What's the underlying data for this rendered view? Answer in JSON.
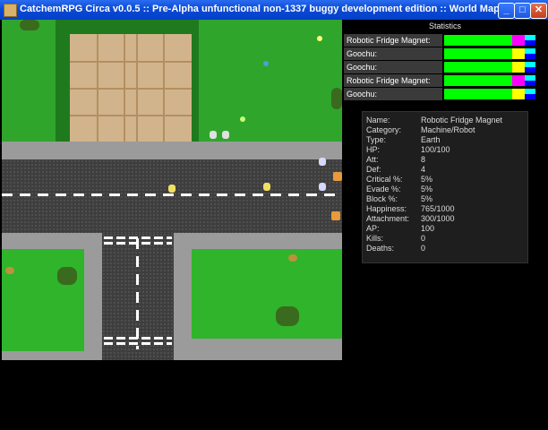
{
  "window": {
    "title": "CatchemRPG Circa v0.0.5 :: Pre-Alpha unfunctional non-1337 buggy development edition :: World Map",
    "minimize_label": "_",
    "maximize_label": "□",
    "close_label": "✕"
  },
  "statistics": {
    "title": "Statistics",
    "rows": [
      {
        "name": "Robotic Fridge Magnet:"
      },
      {
        "name": "Goochu:"
      },
      {
        "name": "Goochu:"
      },
      {
        "name": "Robotic Fridge Magnet:"
      },
      {
        "name": "Goochu:"
      }
    ],
    "colors": {
      "hp": "#00ff00",
      "magenta": "#ff00ff",
      "yellow": "#ffff00",
      "cyan": "#00ffff",
      "blue": "#0000ff"
    }
  },
  "details": [
    {
      "key": "Name:",
      "value": "Robotic Fridge Magnet"
    },
    {
      "key": "Category:",
      "value": "Machine/Robot"
    },
    {
      "key": "Type:",
      "value": "Earth"
    },
    {
      "key": "HP:",
      "value": "100/100"
    },
    {
      "key": "Att:",
      "value": "8"
    },
    {
      "key": "Def:",
      "value": "4"
    },
    {
      "key": "Critical %:",
      "value": "5%"
    },
    {
      "key": "Evade %:",
      "value": "5%"
    },
    {
      "key": "Block %:",
      "value": "5%"
    },
    {
      "key": "Happiness:",
      "value": "765/1000"
    },
    {
      "key": "Attachment:",
      "value": "300/1000"
    },
    {
      "key": "AP:",
      "value": "100"
    },
    {
      "key": "Kills:",
      "value": "0"
    },
    {
      "key": "Deaths:",
      "value": "0"
    }
  ]
}
